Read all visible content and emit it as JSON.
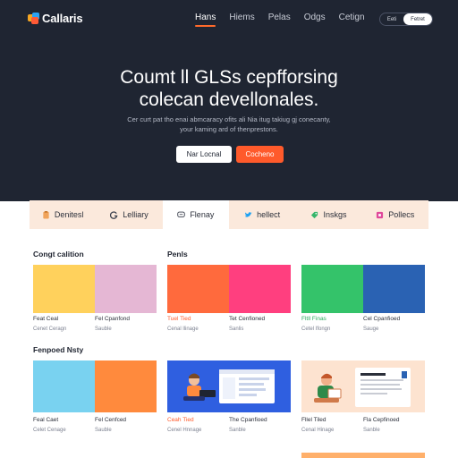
{
  "brand": {
    "name": "Callaris"
  },
  "nav": {
    "items": [
      "Hans",
      "Hiems",
      "Pelas",
      "Odgs",
      "Cetign"
    ]
  },
  "auth": {
    "sign_in": "Eeti",
    "sign_up": "Fetret"
  },
  "hero": {
    "title_line1": "Coumt ll GLSs cepfforsing",
    "title_line2": "colecan devellonales.",
    "subtitle_line1": "Cer curt pat tho enai abmcaracy ofits ali Nia  itug takiug gj conecanty,",
    "subtitle_line2": "your kaming ard of thenprestons.",
    "primary_button": "Nar Locnal",
    "accent_button": "Cocheno"
  },
  "categories": [
    {
      "label": "Denitesl",
      "icon": "clipboard-icon"
    },
    {
      "label": "Lelliary",
      "icon": "g-icon"
    },
    {
      "label": "Flenay",
      "icon": "chat-icon"
    },
    {
      "label": "hellect",
      "icon": "bird-icon"
    },
    {
      "label": "Inskgs",
      "icon": "tag-icon"
    },
    {
      "label": "Pollecs",
      "icon": "square-icon"
    }
  ],
  "sections": {
    "first": "Congt calition",
    "second": "Penls",
    "third": "Fenpoed Nsty"
  },
  "cards_row1": [
    {
      "left": "Feat Ceal",
      "right": "Fel Cpanfond",
      "left_sub": "Cenet Ceragn",
      "right_sub": "Sauble"
    },
    {
      "left": "Tuel Tied",
      "right": "Tet Cenfioned",
      "left_sub": "Cenal llinage",
      "right_sub": "Sanlis"
    },
    {
      "left": "Fltll Finas",
      "right": "Cel Cpanfioed",
      "left_sub": "Cetel Ifongn",
      "right_sub": "Sauge"
    }
  ],
  "cards_row2": [
    {
      "left": "Feal Caet",
      "right": "Fel Cenfced",
      "left_sub": "Celet Cenage",
      "right_sub": "Sauble"
    },
    {
      "left": "Ceah Tied",
      "right": "The Cpanfioed",
      "left_sub": "Cenel Hnnage",
      "right_sub": "Sanble"
    },
    {
      "left": "Fllel Tiled",
      "right": "Fla Cepfinoed",
      "left_sub": "Cenal Hinage",
      "right_sub": "Sanble"
    }
  ],
  "colors": {
    "hero_bg": "#1f2532",
    "accent": "#ff5a2b",
    "cat_bg": "#fbe9dc",
    "tiles_row1": [
      "#ffd15c",
      "#e5b7d4",
      "#ff6a3d",
      "#ff3f7f",
      "#34c36a",
      "#2a62b3"
    ],
    "tiles_row2": [
      "#79d2f0",
      "#ff8a3d",
      "#2f5fe0",
      "#fde3d0"
    ]
  }
}
